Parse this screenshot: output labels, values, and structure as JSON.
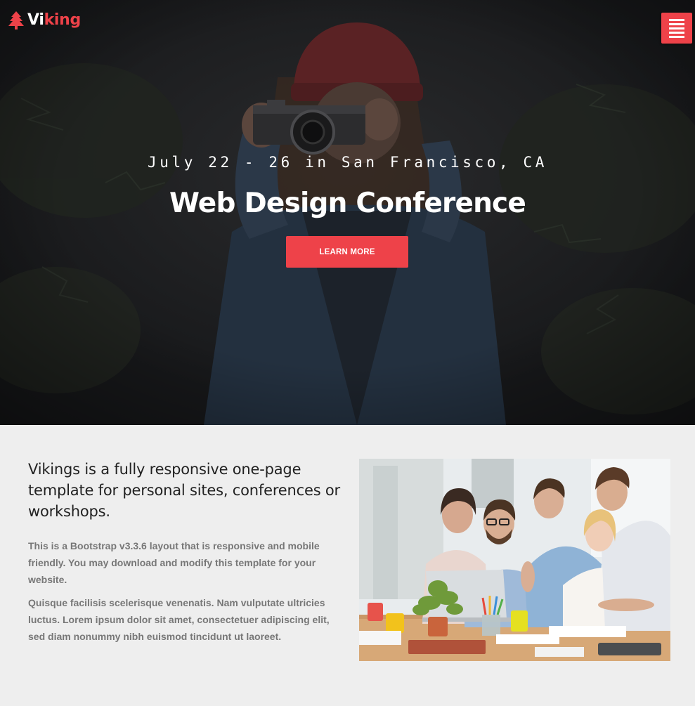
{
  "brand": {
    "logo_part1": "Vi",
    "logo_part2": "king",
    "logo_icon": "pine-tree-icon",
    "primary_color": "#ee4249"
  },
  "nav": {
    "menu_icon": "hamburger-menu-icon"
  },
  "hero": {
    "date_location": "July 22 - 26 in San Francisco, CA",
    "title": "Web Design Conference",
    "cta_label": "LEARN MORE",
    "background_image": "woman-with-camera-photo"
  },
  "about": {
    "heading": "Vikings is a fully responsive one-page template for personal sites, conferences or workshops.",
    "paragraph1": "This is a Bootstrap v3.3.6 layout that is responsive and mobile friendly. You may download and modify this template for your website.",
    "paragraph2": "Quisque facilisis scelerisque venenatis. Nam vulputate ultricies luctus. Lorem ipsum dolor sit amet, consectetuer adipiscing elit, sed diam nonummy nibh euismod tincidunt ut laoreet.",
    "image": "team-meeting-photo"
  }
}
